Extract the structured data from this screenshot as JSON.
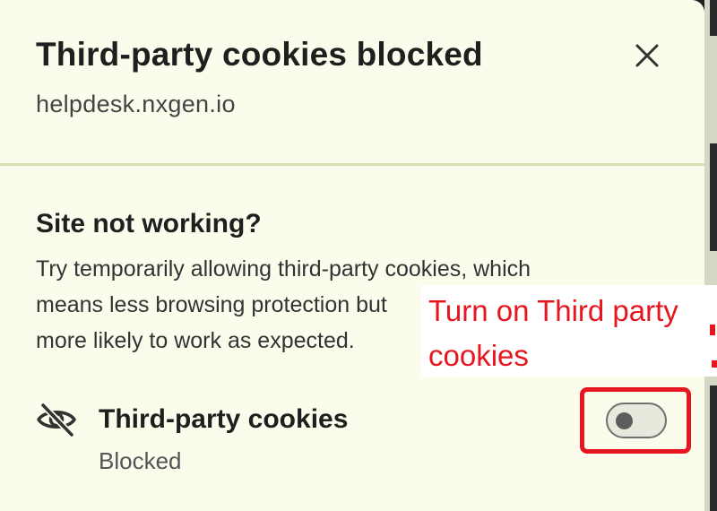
{
  "dialog": {
    "title": "Third-party cookies blocked",
    "site": "helpdesk.nxgen.io",
    "close_icon": "close-icon"
  },
  "help": {
    "heading": "Site not working?",
    "lines": [
      "Try temporarily allowing third-party cookies, which",
      "means less browsing protection but",
      "more likely to work as expected."
    ]
  },
  "setting": {
    "icon": "eye-off-icon",
    "label": "Third-party cookies",
    "status": "Blocked",
    "toggle_on": false
  },
  "annotation": {
    "lines": [
      "Turn on Third party",
      "cookies"
    ],
    "color": "#e5161f"
  },
  "colors": {
    "background": "#fcfcec",
    "divider": "#d9dfae",
    "annotation": "#e5161f"
  }
}
